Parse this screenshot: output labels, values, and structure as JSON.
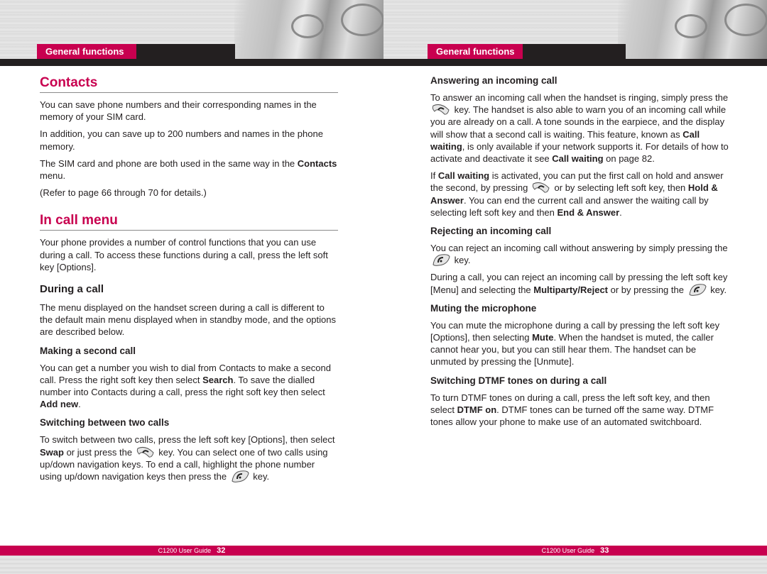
{
  "left_page": {
    "header_tab": "General functions",
    "sections": {
      "contacts": {
        "title": "Contacts",
        "p1": "You can save phone numbers and their corresponding names in the memory of your SIM card.",
        "p2": "In addition, you can save up to 200 numbers and names in the phone memory.",
        "p3_a": "The SIM card and phone are both used in the same way in the ",
        "p3_b": "Contacts",
        "p3_c": " menu.",
        "p4": "(Refer to page 66 through 70 for details.)"
      },
      "in_call_menu": {
        "title": "In call menu",
        "p1": "Your phone provides a number of control functions that you can use during a call. To access these functions during a call, press the left soft key [Options]."
      },
      "during_a_call": {
        "title": "During a call",
        "p1": "The menu displayed on the handset screen during a call is different to the default main menu displayed when in standby mode, and the options are described below."
      },
      "making_second_call": {
        "title": "Making a second call",
        "a": "You can get a number you wish to dial from Contacts to make a second call. Press the right soft key then select ",
        "b": "Search",
        "c": ". To save the dialled number into Contacts during a call, press the right soft key then select ",
        "d": "Add new",
        "e": "."
      },
      "switching_two_calls": {
        "title": "Switching between two calls",
        "a": "To switch between two calls, press the left soft key [Options], then select ",
        "b": "Swap",
        "c": " or just press the ",
        "d": " key. You can select one of two calls using up/down navigation keys. To end a call, highlight the phone number using up/down navigation keys then press the ",
        "e": " key."
      }
    },
    "footer": {
      "guide": "C1200 User Guide",
      "page": "32"
    }
  },
  "right_page": {
    "header_tab": "General functions",
    "sections": {
      "answering": {
        "title": "Answering an incoming call",
        "a": "To answer an incoming call when the handset is ringing, simply press the ",
        "b": " key. The handset is also able to warn you of an incoming call while you are already on a call. A tone sounds in the earpiece, and the display will show that a second call is waiting. This feature, known as ",
        "c": "Call waiting",
        "d": ", is only available if your network supports it. For details of how to activate and deactivate it see ",
        "e": "Call waiting",
        "f": " on page 82.",
        "p2_a": "If ",
        "p2_b": "Call waiting",
        "p2_c": " is activated, you can put the first call on hold and answer the second, by pressing ",
        "p2_d": " or by selecting left soft key, then ",
        "p2_e": "Hold & Answer",
        "p2_f": ". You can end the current call and answer the waiting call by selecting left soft key and then ",
        "p2_g": "End & Answer",
        "p2_h": "."
      },
      "rejecting": {
        "title": "Rejecting an incoming call",
        "p1_a": "You can reject an incoming call without answering by simply pressing the ",
        "p1_b": " key.",
        "p2_a": "During a call, you can reject an incoming call by pressing the left soft key [Menu] and selecting the ",
        "p2_b": "Multiparty/Reject",
        "p2_c": " or by pressing the ",
        "p2_d": " key."
      },
      "muting": {
        "title": "Muting the microphone",
        "a": "You can mute the microphone during a call by pressing the left soft key [Options], then selecting ",
        "b": "Mute",
        "c": ". When the handset is muted, the caller cannot hear you, but you can still hear them. The handset can be unmuted by pressing the [Unmute]."
      },
      "dtmf": {
        "title": "Switching DTMF tones on during a call",
        "a": "To turn DTMF tones on during a call, press the left soft key, and then select ",
        "b": "DTMF on",
        "c": ". DTMF tones can be turned off the same way. DTMF tones allow your phone to make use of an automated switchboard."
      }
    },
    "footer": {
      "guide": "C1200 User Guide",
      "page": "33"
    }
  },
  "icons": {
    "send_key": "send-key-icon",
    "end_key": "end-key-icon"
  },
  "colors": {
    "accent": "#c8004f",
    "dark": "#231f20"
  }
}
